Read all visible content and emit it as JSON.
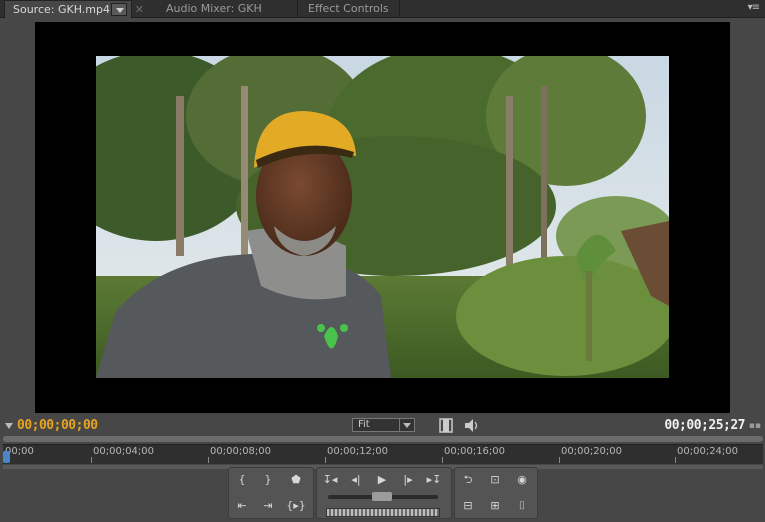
{
  "tabs": [
    {
      "label": "Source: GKH.mp4",
      "active": true
    },
    {
      "label": "Audio Mixer: GKH",
      "active": false
    },
    {
      "label": "Effect Controls",
      "active": false
    }
  ],
  "panel_menu_icon": "panel-menu-icon",
  "timecode": {
    "current": "00;00;00;00",
    "duration": "00;00;25;27"
  },
  "zoom": {
    "selected": "Fit"
  },
  "ruler": {
    "labels": [
      "00;00",
      "00;00;04;00",
      "00;00;08;00",
      "00;00;12;00",
      "00;00;16;00",
      "00;00;20;00",
      "00;00;24;00"
    ]
  },
  "colors": {
    "timecode_current": "#e7a322",
    "playhead": "#4a86c6",
    "panel_bg": "#474747"
  },
  "transport": {
    "icons": [
      "mark-in-icon",
      "mark-out-icon",
      "set-marker-icon",
      "go-to-in-icon",
      "go-to-out-icon",
      "play-in-to-out-icon",
      "go-to-previous-marker-icon",
      "step-back-icon",
      "play-icon",
      "step-forward-icon",
      "go-to-next-marker-icon",
      "loop-icon",
      "safe-margins-icon",
      "output-icon",
      "insert-icon",
      "overlay-icon",
      "export-frame-icon"
    ]
  }
}
